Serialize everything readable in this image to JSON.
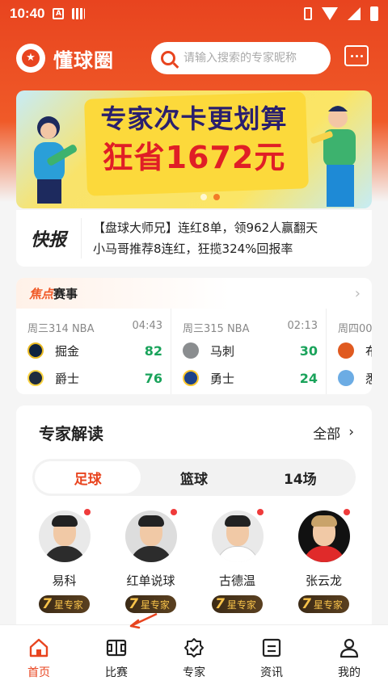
{
  "status_bar": {
    "time": "10:40"
  },
  "app": {
    "name": "懂球圈"
  },
  "search": {
    "placeholder": "请输入搜索的专家昵称"
  },
  "banner": {
    "line1": "专家次卡更划算",
    "line2": "狂省1672元",
    "slide_count": 2,
    "active_slide": 2
  },
  "news": {
    "tag": "快报",
    "lines": [
      "【盘球大师兄】连红8单，领962人赢翻天",
      "小马哥推荐8连红，狂揽324%回报率"
    ]
  },
  "focus": {
    "title_highlight": "焦点",
    "title_rest": "赛事",
    "matches": [
      {
        "info": "周三314 NBA",
        "time": "04:43",
        "home": "掘金",
        "home_score": "82",
        "away": "爵士",
        "away_score": "76",
        "home_color": "#e8b923",
        "away_color": "#1f2c3f"
      },
      {
        "info": "周三315 NBA",
        "time": "02:13",
        "home": "马刺",
        "home_score": "30",
        "away": "勇士",
        "away_score": "24",
        "home_color": "#8a8d8f",
        "away_color": "#1d428a"
      },
      {
        "info": "周四00:",
        "time": "",
        "home": "布",
        "home_score": "",
        "away": "悉",
        "away_score": "",
        "home_color": "#e05a20",
        "away_color": "#6cace4"
      }
    ]
  },
  "experts": {
    "title": "专家解读",
    "all_label": "全部",
    "tabs": [
      "足球",
      "篮球",
      "14场"
    ],
    "active_tab": "足球",
    "list": [
      {
        "name": "易科",
        "star": "7",
        "badge": "星专家"
      },
      {
        "name": "红单说球",
        "star": "7",
        "badge": "星专家"
      },
      {
        "name": "古德温",
        "star": "7",
        "badge": "星专家"
      },
      {
        "name": "张云龙",
        "star": "7",
        "badge": "星专家"
      }
    ]
  },
  "nav": {
    "items": [
      {
        "label": "首页",
        "icon": "home-icon",
        "active": true
      },
      {
        "label": "比赛",
        "icon": "court-icon",
        "active": false
      },
      {
        "label": "专家",
        "icon": "badge-check-icon",
        "active": false
      },
      {
        "label": "资讯",
        "icon": "news-icon",
        "active": false
      },
      {
        "label": "我的",
        "icon": "user-icon",
        "active": false
      }
    ]
  },
  "colors": {
    "brand": "#e8441f",
    "score_green": "#1aa35b"
  }
}
